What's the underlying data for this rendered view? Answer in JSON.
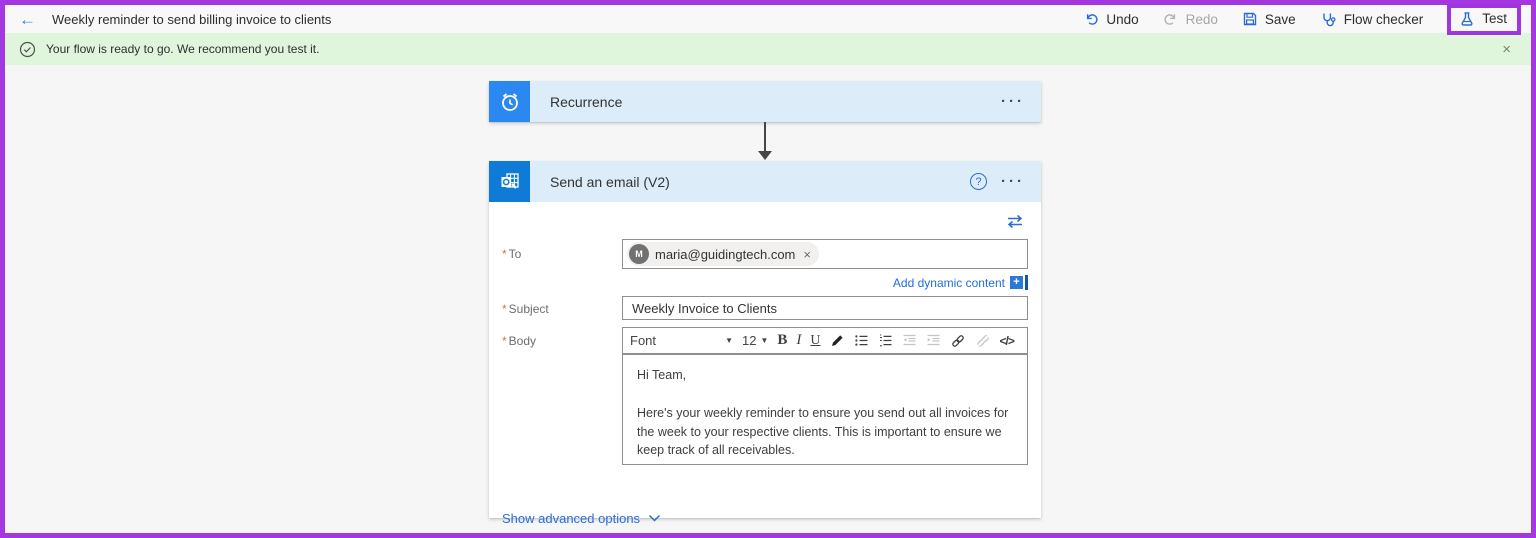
{
  "topbar": {
    "title": "Weekly reminder to send billing invoice to clients",
    "undo": "Undo",
    "redo": "Redo",
    "save": "Save",
    "flow_checker": "Flow checker",
    "test": "Test"
  },
  "banner": {
    "message": "Your flow is ready to go. We recommend you test it."
  },
  "trigger_card": {
    "title": "Recurrence"
  },
  "action_card": {
    "title": "Send an email (V2)",
    "required_mark": "*",
    "to_label": "To",
    "to_chip": {
      "initial": "M",
      "email": "maria@guidingtech.com"
    },
    "add_dynamic_content": "Add dynamic content",
    "subject_label": "Subject",
    "subject_value": "Weekly Invoice to Clients",
    "body_label": "Body",
    "toolbar": {
      "font": "Font",
      "size": "12",
      "bold": "B",
      "italic": "I",
      "underline": "U",
      "code": "</>"
    },
    "body_text": {
      "p1": "Hi Team,",
      "p2": "Here's your weekly reminder to ensure you send out all invoices for the week to your respective clients. This is important to ensure we keep track of all receivables."
    },
    "show_advanced": "Show advanced options"
  },
  "icons": {
    "back": "←",
    "more_options": "···",
    "help": "?",
    "close": "×",
    "chip_remove": "×",
    "caret": "▼"
  },
  "colors": {
    "annotation_purple": "#a437e0",
    "banner_green": "#dff6dd",
    "card_header_blue": "#dcecf9",
    "trigger_tile_blue": "#2a88f0",
    "outlook_tile_blue": "#0f7bd7",
    "link_blue": "#1f6fd6"
  }
}
